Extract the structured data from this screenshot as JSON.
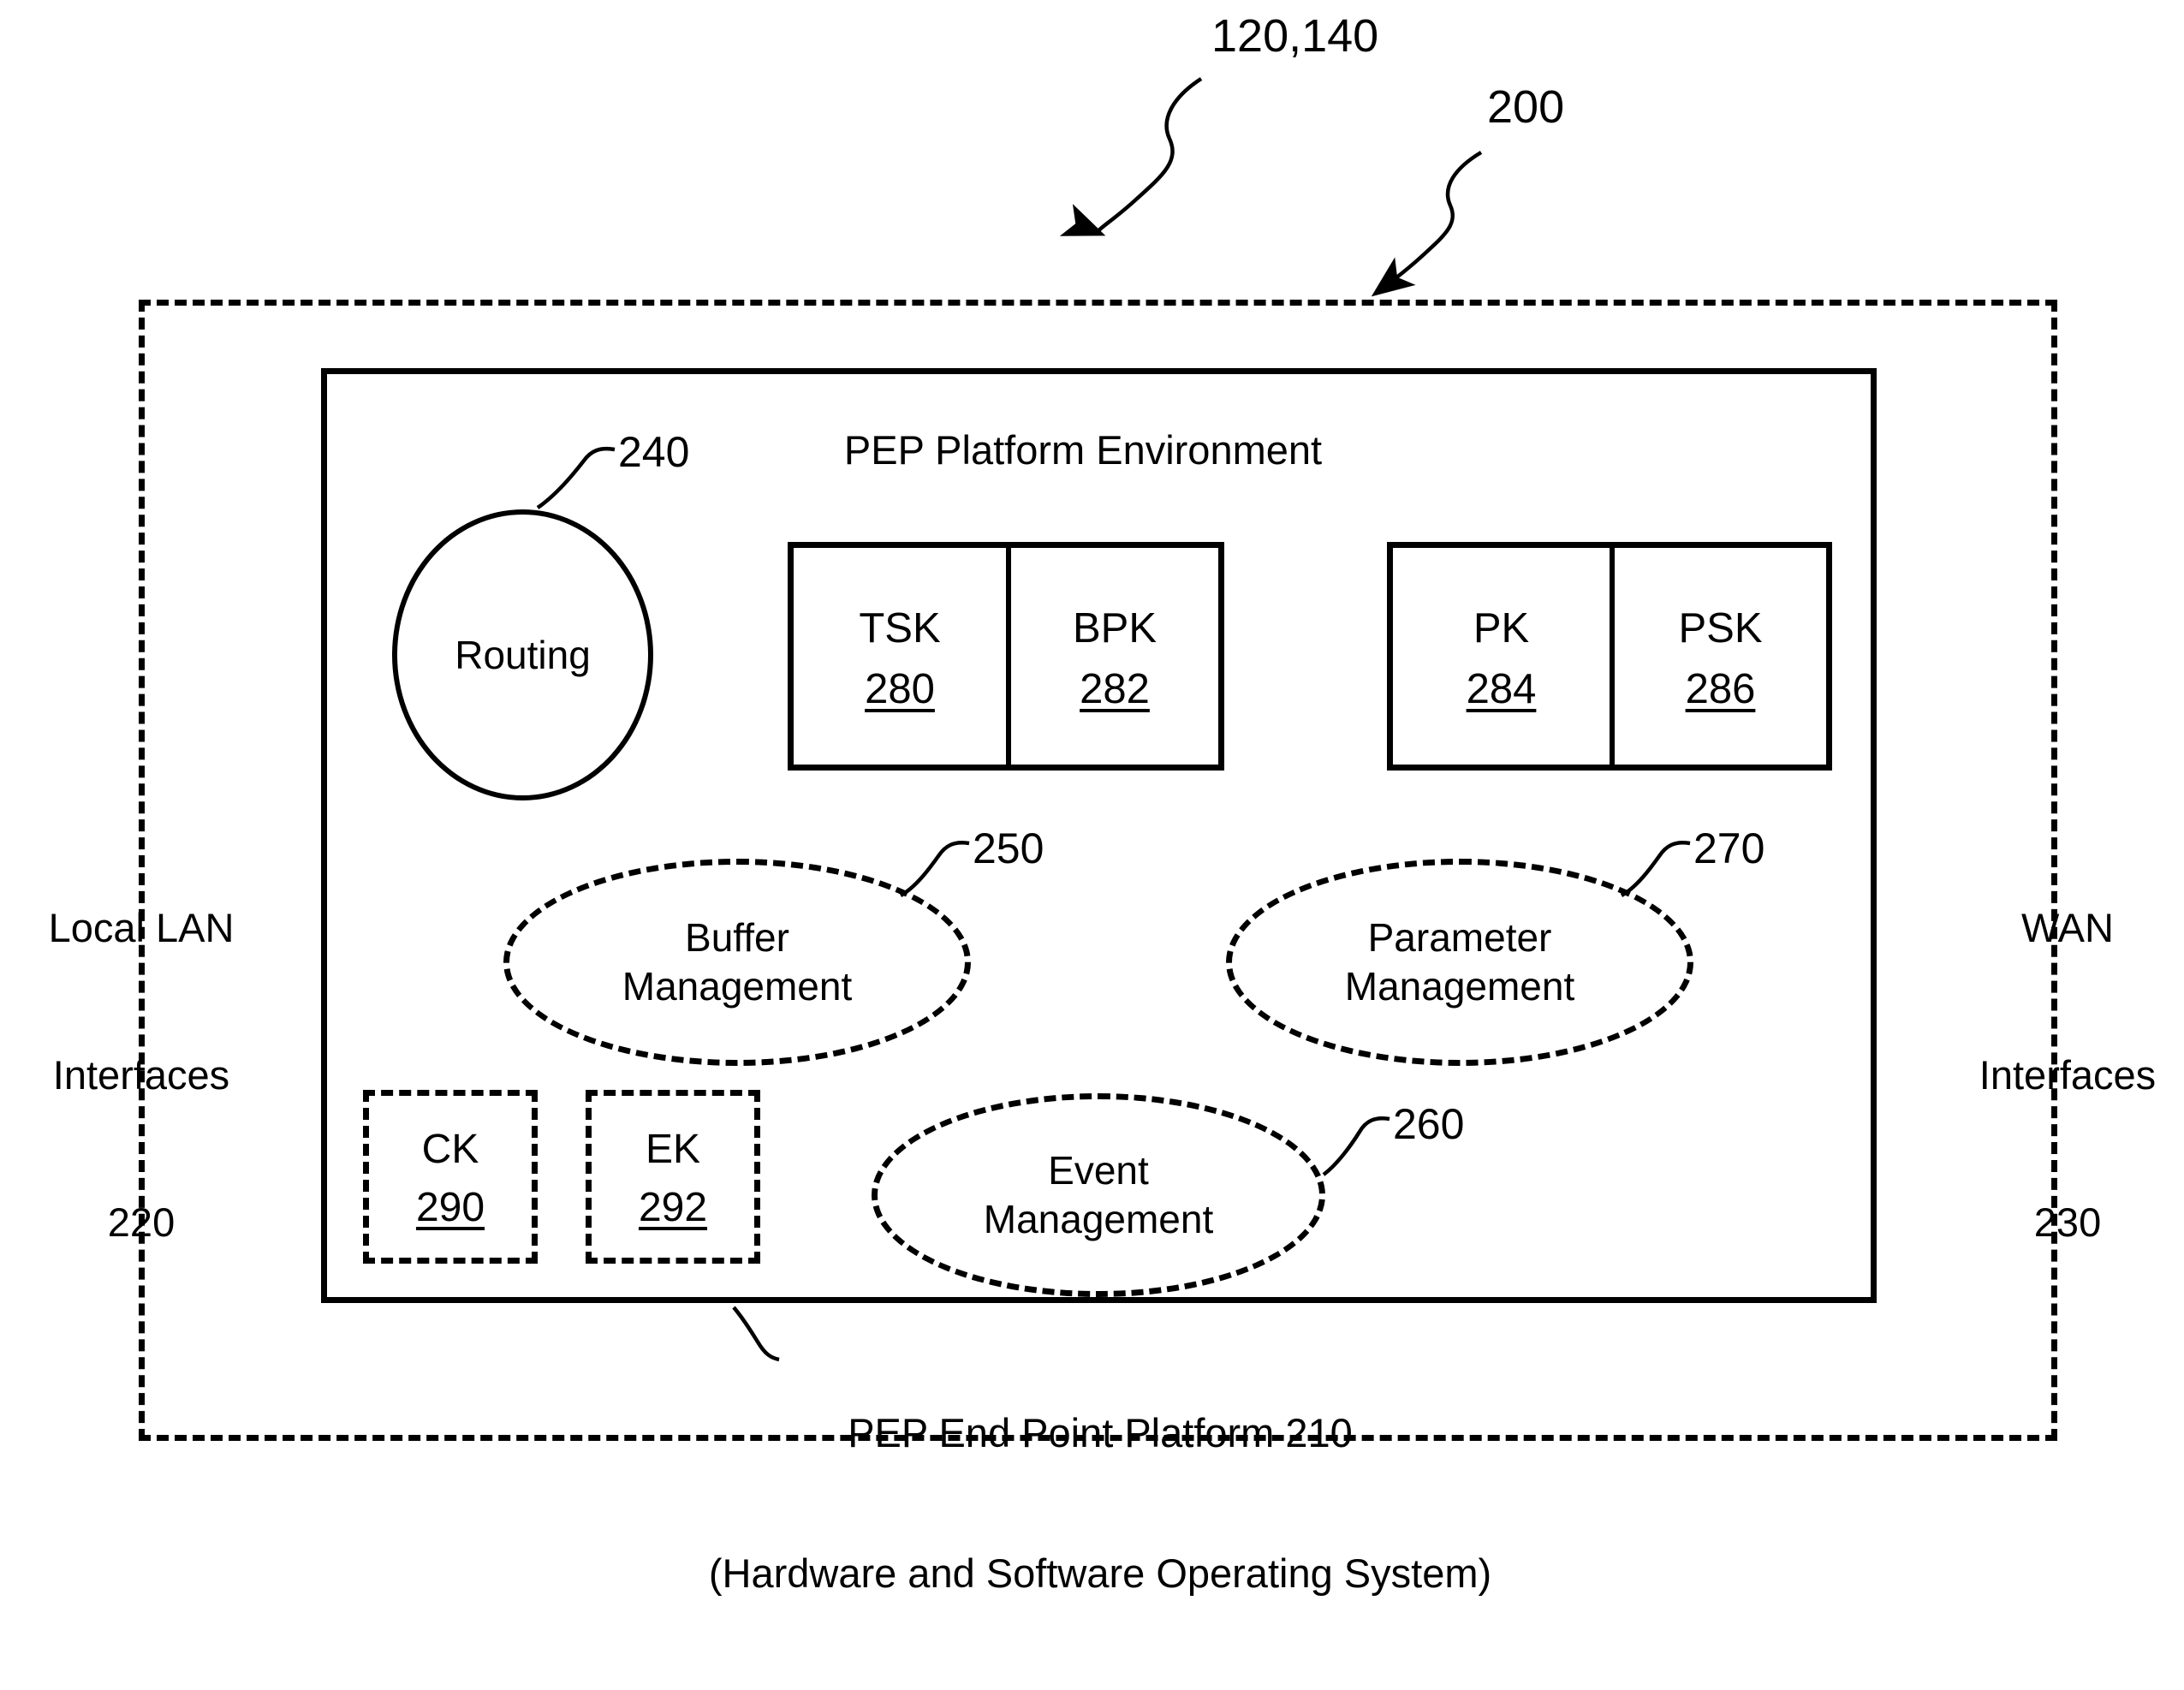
{
  "figure": {
    "title_label": "PEP Platform Environment",
    "outer_reference": "120,140",
    "platform_reference": "200"
  },
  "left_interfaces": {
    "line1": "Local LAN",
    "line2": "Interfaces",
    "line3": "220"
  },
  "right_interfaces": {
    "line1": "WAN",
    "line2": "Interfaces",
    "line3": "230"
  },
  "routing": {
    "label": "Routing",
    "reference": "240"
  },
  "key_groups": [
    {
      "id": "tsk-bpk",
      "cells": [
        {
          "name": "TSK",
          "number": "280"
        },
        {
          "name": "BPK",
          "number": "282"
        }
      ]
    },
    {
      "id": "pk-psk",
      "cells": [
        {
          "name": "PK",
          "number": "284"
        },
        {
          "name": "PSK",
          "number": "286"
        }
      ]
    }
  ],
  "dashed_key_boxes": [
    {
      "name": "CK",
      "number": "290"
    },
    {
      "name": "EK",
      "number": "292"
    }
  ],
  "management_ellipses": [
    {
      "line1": "Buffer",
      "line2": "Management",
      "reference": "250"
    },
    {
      "line1": "Parameter",
      "line2": "Management",
      "reference": "270"
    },
    {
      "line1": "Event",
      "line2": "Management",
      "reference": "260"
    }
  ],
  "caption": {
    "line1": "PEP End Point Platform 210",
    "line2": "(Hardware and Software Operating System)"
  },
  "colors": {
    "ink": "#000000",
    "paper": "#ffffff"
  }
}
